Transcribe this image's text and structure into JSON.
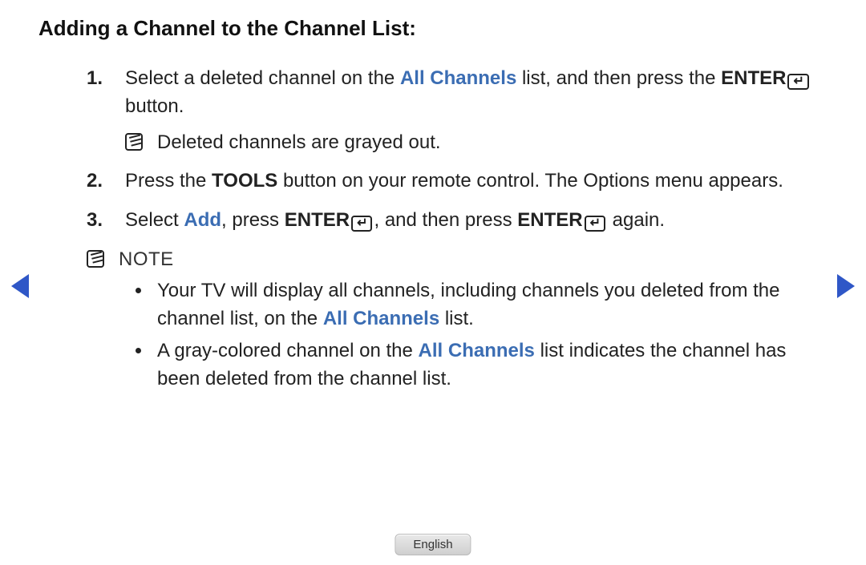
{
  "title": "Adding a Channel to the Channel List:",
  "steps": {
    "s1": {
      "num": "1.",
      "a": "Select a deleted channel on the ",
      "link": "All Channels",
      "b": " list, and then press the ",
      "enterWord": "ENTER",
      "enterGlyph": "↵",
      "c": " button.",
      "sub": "Deleted channels are grayed out."
    },
    "s2": {
      "num": "2.",
      "a": "Press the ",
      "tools": "TOOLS",
      "b": " button on your remote control. The Options menu appears."
    },
    "s3": {
      "num": "3.",
      "a": "Select ",
      "add": "Add",
      "b": ", press ",
      "enterWord1": "ENTER",
      "enterGlyph1": "↵",
      "c": ", and then press ",
      "enterWord2": "ENTER",
      "enterGlyph2": "↵",
      "d": " again."
    }
  },
  "noteLabel": "NOTE",
  "notes": {
    "n1": {
      "a": "Your TV will display all channels, including channels you deleted from the channel list, on the ",
      "link": "All Channels",
      "b": " list."
    },
    "n2": {
      "a": "A gray-colored channel on the ",
      "link": "All Channels",
      "b": " list indicates the channel has been deleted from the channel list."
    }
  },
  "language": "English"
}
